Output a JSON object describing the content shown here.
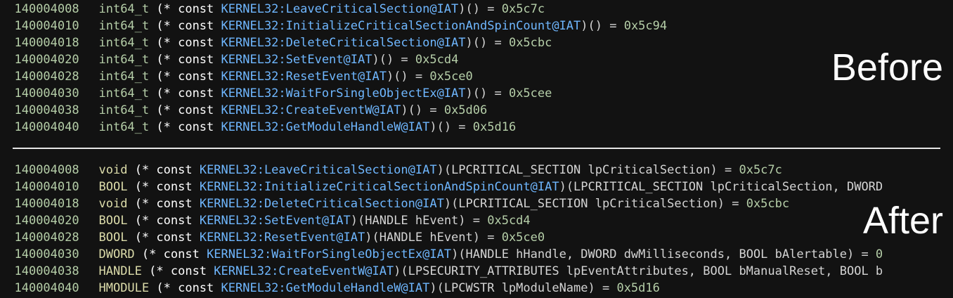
{
  "before": {
    "label": "Before",
    "lines": [
      {
        "addr": "140004008",
        "type": "int64_t",
        "kw": "(* const",
        "sym": "KERNEL32:LeaveCriticalSection@IAT",
        "rest": ")() = ",
        "val": "0x5c7c"
      },
      {
        "addr": "140004010",
        "type": "int64_t",
        "kw": "(* const",
        "sym": "KERNEL32:InitializeCriticalSectionAndSpinCount@IAT",
        "rest": ")() = ",
        "val": "0x5c94"
      },
      {
        "addr": "140004018",
        "type": "int64_t",
        "kw": "(* const",
        "sym": "KERNEL32:DeleteCriticalSection@IAT",
        "rest": ")() = ",
        "val": "0x5cbc"
      },
      {
        "addr": "140004020",
        "type": "int64_t",
        "kw": "(* const",
        "sym": "KERNEL32:SetEvent@IAT",
        "rest": ")() = ",
        "val": "0x5cd4"
      },
      {
        "addr": "140004028",
        "type": "int64_t",
        "kw": "(* const",
        "sym": "KERNEL32:ResetEvent@IAT",
        "rest": ")() = ",
        "val": "0x5ce0"
      },
      {
        "addr": "140004030",
        "type": "int64_t",
        "kw": "(* const",
        "sym": "KERNEL32:WaitForSingleObjectEx@IAT",
        "rest": ")() = ",
        "val": "0x5cee"
      },
      {
        "addr": "140004038",
        "type": "int64_t",
        "kw": "(* const",
        "sym": "KERNEL32:CreateEventW@IAT",
        "rest": ")() = ",
        "val": "0x5d06"
      },
      {
        "addr": "140004040",
        "type": "int64_t",
        "kw": "(* const",
        "sym": "KERNEL32:GetModuleHandleW@IAT",
        "rest": ")() = ",
        "val": "0x5d16"
      }
    ]
  },
  "after": {
    "label": "After",
    "lines": [
      {
        "addr": "140004008",
        "type": "void",
        "kw": "(* const",
        "sym": "KERNEL32:LeaveCriticalSection@IAT",
        "params": ")(LPCRITICAL_SECTION lpCriticalSection) = ",
        "val": "0x5c7c"
      },
      {
        "addr": "140004010",
        "type": "BOOL",
        "kw": "(* const",
        "sym": "KERNEL32:InitializeCriticalSectionAndSpinCount@IAT",
        "params": ")(LPCRITICAL_SECTION lpCriticalSection, DWORD",
        "val": ""
      },
      {
        "addr": "140004018",
        "type": "void",
        "kw": "(* const",
        "sym": "KERNEL32:DeleteCriticalSection@IAT",
        "params": ")(LPCRITICAL_SECTION lpCriticalSection) = ",
        "val": "0x5cbc"
      },
      {
        "addr": "140004020",
        "type": "BOOL",
        "kw": "(* const",
        "sym": "KERNEL32:SetEvent@IAT",
        "params": ")(HANDLE hEvent) = ",
        "val": "0x5cd4"
      },
      {
        "addr": "140004028",
        "type": "BOOL",
        "kw": "(* const",
        "sym": "KERNEL32:ResetEvent@IAT",
        "params": ")(HANDLE hEvent) = ",
        "val": "0x5ce0"
      },
      {
        "addr": "140004030",
        "type": "DWORD",
        "kw": "(* const",
        "sym": "KERNEL32:WaitForSingleObjectEx@IAT",
        "params": ")(HANDLE hHandle, DWORD dwMilliseconds, BOOL bAlertable) = ",
        "val": "0"
      },
      {
        "addr": "140004038",
        "type": "HANDLE",
        "kw": "(* const",
        "sym": "KERNEL32:CreateEventW@IAT",
        "params": ")(LPSECURITY_ATTRIBUTES lpEventAttributes, BOOL bManualReset, BOOL b",
        "val": ""
      },
      {
        "addr": "140004040",
        "type": "HMODULE",
        "kw": "(* const",
        "sym": "KERNEL32:GetModuleHandleW@IAT",
        "params": ")(LPCWSTR lpModuleName) = ",
        "val": "0x5d16"
      }
    ]
  }
}
